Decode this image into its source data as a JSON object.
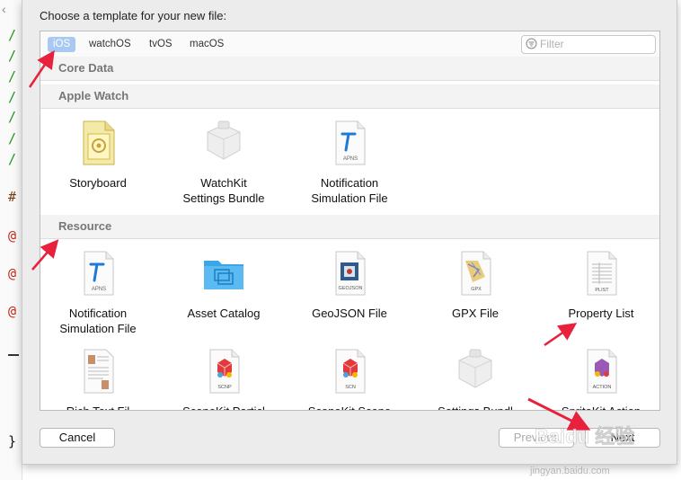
{
  "dialog": {
    "title": "Choose a template for your new file:"
  },
  "tabs": [
    {
      "label": "iOS",
      "selected": true
    },
    {
      "label": "watchOS",
      "selected": false
    },
    {
      "label": "tvOS",
      "selected": false
    },
    {
      "label": "macOS",
      "selected": false
    }
  ],
  "filter": {
    "placeholder": "Filter",
    "value": ""
  },
  "sections": {
    "core_data": "Core Data",
    "apple_watch": "Apple Watch",
    "resource": "Resource"
  },
  "apple_watch_items": [
    {
      "line1": "Storyboard",
      "line2": "",
      "icon": "storyboard-icon"
    },
    {
      "line1": "WatchKit",
      "line2": "Settings Bundle",
      "icon": "watchkit-bundle-icon"
    },
    {
      "line1": "Notification",
      "line2": "Simulation File",
      "icon": "apns-file-icon"
    }
  ],
  "resource_items": [
    {
      "line1": "Notification",
      "line2": "Simulation File",
      "icon": "apns-file-icon"
    },
    {
      "line1": "Asset Catalog",
      "line2": "",
      "icon": "folder-icon"
    },
    {
      "line1": "GeoJSON File",
      "line2": "",
      "icon": "geojson-file-icon",
      "badge": "GEOJSON"
    },
    {
      "line1": "GPX File",
      "line2": "",
      "icon": "gpx-file-icon",
      "badge": "GPX"
    },
    {
      "line1": "Property List",
      "line2": "",
      "icon": "plist-file-icon",
      "badge": "PLIST"
    }
  ],
  "resource_row2": [
    {
      "partial_label": "Rich Text Fil",
      "icon": "rtf-file-icon"
    },
    {
      "partial_label": "SceneKit Particl",
      "icon": "scnp-file-icon",
      "badge": "SCNP"
    },
    {
      "partial_label": "SceneKit Scene",
      "icon": "scn-file-icon",
      "badge": "SCN"
    },
    {
      "partial_label": "Settings Bundl",
      "icon": "settings-bundle-icon"
    },
    {
      "partial_label": "SpriteKit Action",
      "icon": "action-file-icon",
      "badge": "ACTION"
    }
  ],
  "icon_badges": {
    "apns": "APNS"
  },
  "buttons": {
    "cancel": "Cancel",
    "previous": "Previous",
    "next": "Next"
  },
  "editor": {
    "comment_marks": [
      "/",
      "/",
      "/",
      "/",
      "/",
      "/",
      "/"
    ],
    "hash_mark": "#",
    "at_marks": [
      "@",
      "@",
      "@"
    ],
    "brace": "}"
  },
  "watermark": {
    "brand": "Baidu 经验",
    "url": "jingyan.baidu.com"
  },
  "colors": {
    "accent_tab": "#a9c9f3",
    "arrow": "#e8213c",
    "comment_green": "#1f9a1f",
    "at_red": "#c0281c"
  }
}
